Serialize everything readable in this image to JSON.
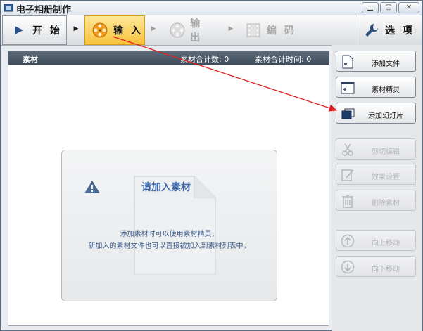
{
  "window": {
    "title": "电子相册制作",
    "controls": [
      "minimize-icon",
      "maximize-icon",
      "close-icon"
    ]
  },
  "toolbar": {
    "start": {
      "label": "开 始",
      "icon": "play-arrow-icon"
    },
    "input": {
      "label": "输 入",
      "icon": "film-reel-icon",
      "active": true
    },
    "output": {
      "label": "输 出",
      "icon": "film-reel-icon",
      "disabled": true
    },
    "encode": {
      "label": "编 码",
      "icon": "filmstrip-icon",
      "disabled": true
    },
    "options": {
      "label": "选 项",
      "icon": "wrench-icon"
    }
  },
  "panel": {
    "title": "素材",
    "count_label": "素材合计数: 0",
    "time_label": "素材合计时间: 0"
  },
  "placeholder": {
    "title": "请加入素材",
    "line1": "添加素材时可以使用素材精灵，",
    "line2": "新加入的素材文件也可以直接被加入到素材列表中。"
  },
  "sidebar": {
    "add_file": "添加文件",
    "wizard": "素材精灵",
    "add_slides": "添加幻灯片",
    "cut_edit": "剪切编辑",
    "effects": "效果设置",
    "delete": "删除素材",
    "move_up": "向上移动",
    "move_down": "向下移动"
  },
  "colors": {
    "active_tab": "#f7c23a",
    "panel_header": "#4a5767",
    "placeholder_text": "#3b66a8",
    "annotation_arrow": "#e02020"
  }
}
